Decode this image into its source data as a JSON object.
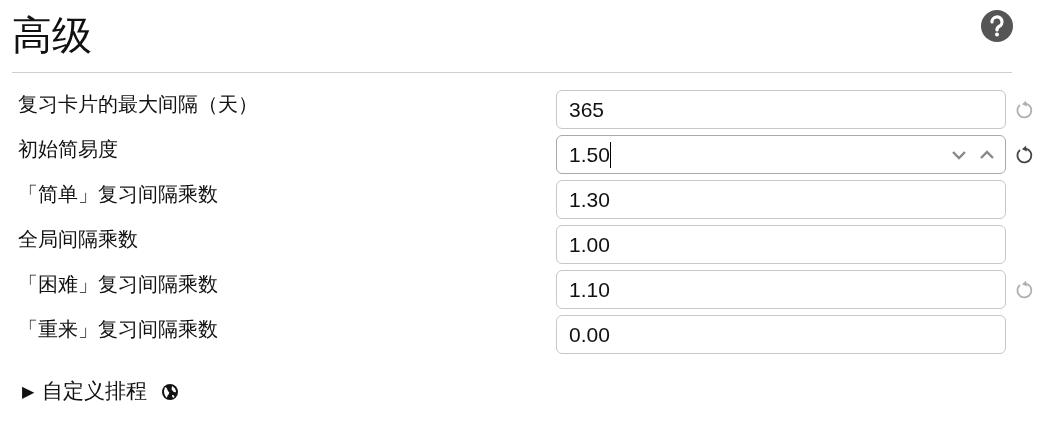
{
  "title": "高级",
  "rows": [
    {
      "label": "复习卡片的最大间隔（天）",
      "value": "365",
      "focused": false,
      "resettable": true,
      "reset_highlighted": false
    },
    {
      "label": "初始简易度",
      "value": "1.50",
      "focused": true,
      "resettable": true,
      "reset_highlighted": true
    },
    {
      "label": "「简单」复习间隔乘数",
      "value": "1.30",
      "focused": false,
      "resettable": false
    },
    {
      "label": "全局间隔乘数",
      "value": "1.00",
      "focused": false,
      "resettable": false
    },
    {
      "label": "「困难」复习间隔乘数",
      "value": "1.10",
      "focused": false,
      "resettable": true,
      "reset_highlighted": false
    },
    {
      "label": "「重来」复习间隔乘数",
      "value": "0.00",
      "focused": false,
      "resettable": false
    }
  ],
  "section": {
    "marker": "▶",
    "label": "自定义排程"
  }
}
